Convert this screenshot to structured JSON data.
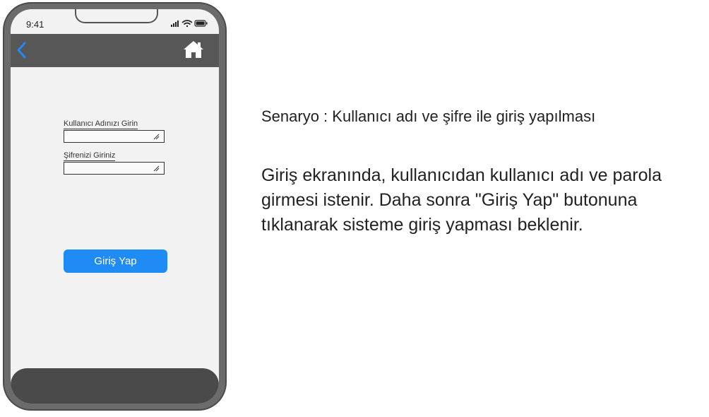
{
  "status_bar": {
    "time": "9:41",
    "icons": [
      "signal-icon",
      "wifi-icon",
      "battery-icon"
    ]
  },
  "nav": {
    "back_icon": "chevron-left-icon",
    "home_icon": "home-icon"
  },
  "form": {
    "username_label": "Kullanıcı Adınızı Girin",
    "username_value": "",
    "password_label": "Şifrenizi Giriniz",
    "password_value": "",
    "login_label": "Giriş Yap"
  },
  "scenario": {
    "title": "Senaryo : Kullanıcı adı ve şifre ile giriş yapılması",
    "description": "Giriş ekranında, kullanıcıdan kullanıcı adı ve parola girmesi istenir. Daha sonra \"Giriş Yap\" butonuna tıklanarak sisteme giriş yapması beklenir."
  },
  "colors": {
    "accent": "#1f8bf5",
    "nav_bar": "#575757",
    "bezel": "#6b6b6b",
    "screen": "#f2f2f2"
  }
}
